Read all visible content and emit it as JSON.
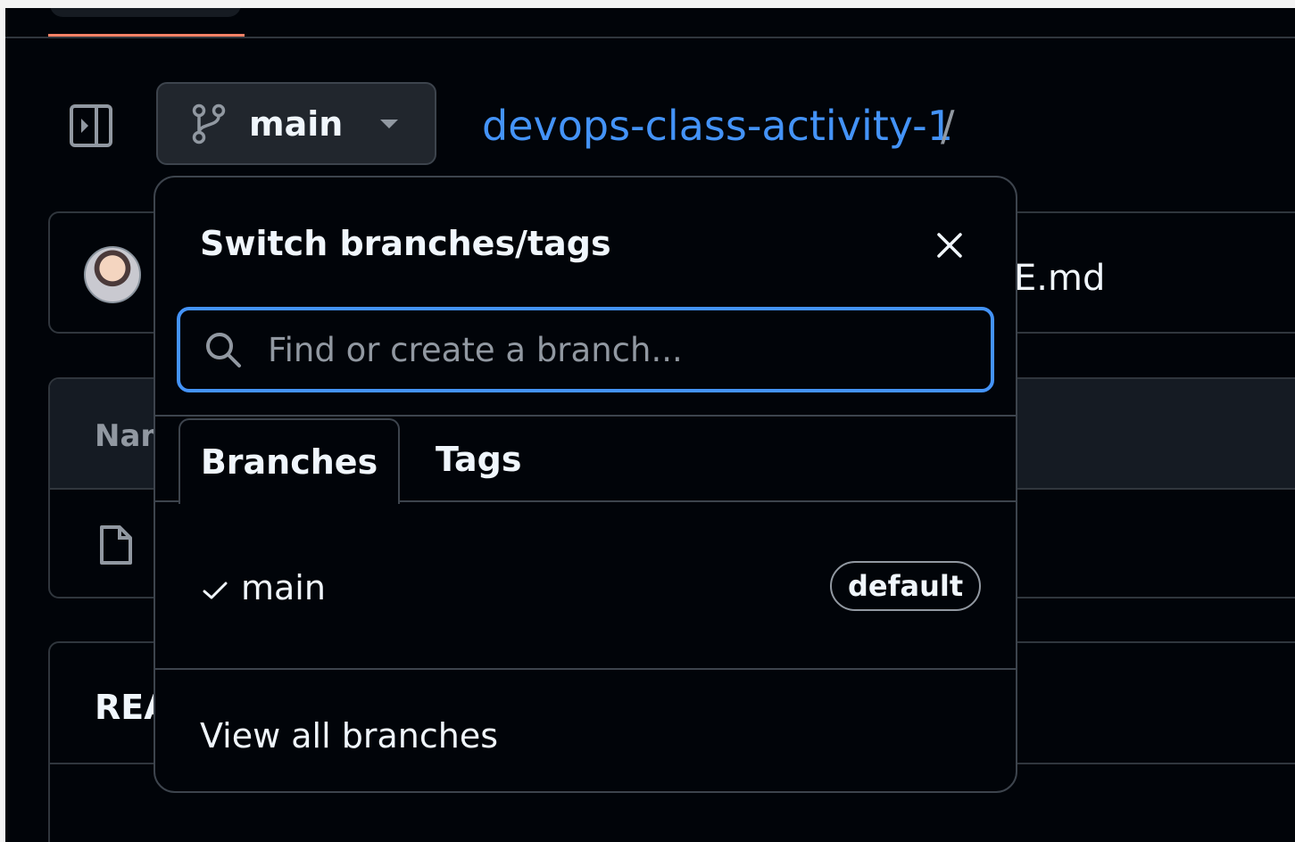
{
  "header": {
    "branch_button_label": "main",
    "repo_name": "devops-class-activity-1",
    "path_separator": "/"
  },
  "background": {
    "readme_crumb": "E.md",
    "files_header_label": "Nam",
    "readme_title": "REA"
  },
  "overlay": {
    "title": "Switch branches/tags",
    "search": {
      "placeholder": "Find or create a branch..."
    },
    "tabs": [
      {
        "label": "Branches",
        "active": true
      },
      {
        "label": "Tags",
        "active": false
      }
    ],
    "branches": [
      {
        "name": "main",
        "selected": true,
        "badge": "default"
      }
    ],
    "view_all_label": "View all branches"
  },
  "colors": {
    "accent": "#4493f8",
    "background": "#010409",
    "border": "#3d444d",
    "tab_underline": "#f78166"
  },
  "icons": [
    "sidebar-toggle-icon",
    "git-branch-icon",
    "caret-down-icon",
    "close-icon",
    "search-icon",
    "check-icon",
    "file-icon",
    "avatar"
  ]
}
